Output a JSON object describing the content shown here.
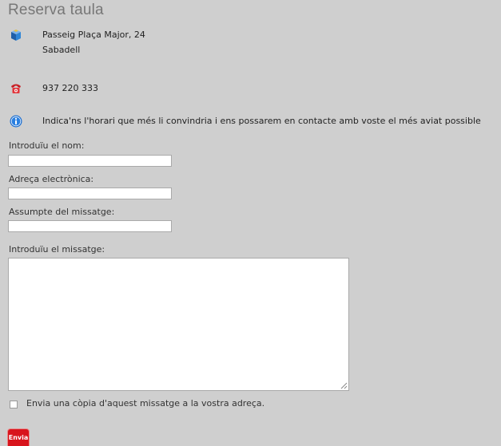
{
  "page": {
    "title": "Reserva taula"
  },
  "contact": {
    "address_line1": "Passeig Plaça Major, 24",
    "address_line2": "Sabadell",
    "phone": "937 220 333",
    "info": "Indica'ns l'horari que més li convindria i ens possarem en contacte amb voste el més aviat possible"
  },
  "form": {
    "name_label": "Introduïu el nom:",
    "name_value": "",
    "email_label": "Adreça electrònica:",
    "email_value": "",
    "subject_label": "Assumpte del missatge:",
    "subject_value": "",
    "message_label": "Introduïu el missatge:",
    "message_value": "",
    "copy_label": "Envia una còpia d'aquest missatge a la vostra adreça.",
    "copy_checked": false,
    "submit_label": "Envia"
  },
  "icons": {
    "address": "location-cube-icon",
    "phone": "telephone-icon",
    "info": "info-icon"
  },
  "colors": {
    "background": "#cfcfcf",
    "title": "#777777",
    "submit": "#d8141c",
    "info_icon": "#1e6fd0"
  }
}
